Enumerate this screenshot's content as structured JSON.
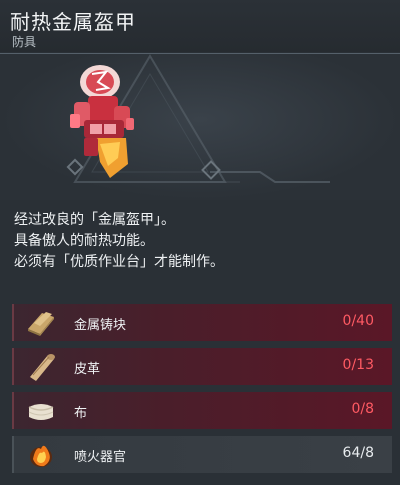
{
  "item": {
    "title": "耐热金属盔甲",
    "category": "防具"
  },
  "description": [
    "经过改良的「金属盔甲」。",
    "具备傲人的耐热功能。",
    "必须有「优质作业台」才能制作。"
  ],
  "materials": [
    {
      "name": "金属铸块",
      "count": "0/40",
      "icon": "metal-ingot-icon",
      "enough": false
    },
    {
      "name": "皮革",
      "count": "0/13",
      "icon": "leather-icon",
      "enough": false
    },
    {
      "name": "布",
      "count": "0/8",
      "icon": "cloth-icon",
      "enough": false
    },
    {
      "name": "喷火器官",
      "count": "64/8",
      "icon": "flame-organ-icon",
      "enough": true
    }
  ],
  "colors": {
    "insufficient": "#ff5a63",
    "sufficient": "#e8ecef",
    "background": "#2a3036"
  }
}
